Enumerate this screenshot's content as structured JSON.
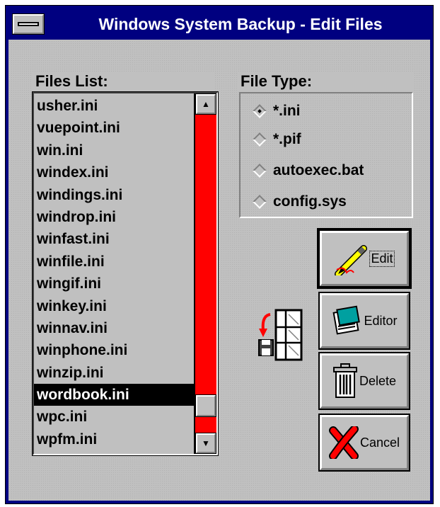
{
  "window": {
    "title": "Windows System Backup - Edit  Files"
  },
  "files": {
    "label": "Files List:",
    "items": [
      "usher.ini",
      "vuepoint.ini",
      "win.ini",
      "windex.ini",
      "windings.ini",
      "windrop.ini",
      "winfast.ini",
      "winfile.ini",
      "wingif.ini",
      "winkey.ini",
      "winnav.ini",
      "winphone.ini",
      "winzip.ini",
      "wordbook.ini",
      "wpc.ini",
      "wpfm.ini"
    ],
    "selected": "wordbook.ini"
  },
  "file_type": {
    "label": "File Type:",
    "options": [
      {
        "label": "*.ini",
        "checked": true
      },
      {
        "label": "*.pif",
        "checked": false
      },
      {
        "label": "autoexec.bat",
        "checked": false
      },
      {
        "label": "config.sys",
        "checked": false
      }
    ]
  },
  "buttons": {
    "edit": "Edit",
    "editor": "Editor",
    "delete": "Delete",
    "cancel": "Cancel"
  },
  "colors": {
    "titlebar": "#000080",
    "scrollbar_track": "#ff0000",
    "face": "#c0c0c0"
  }
}
